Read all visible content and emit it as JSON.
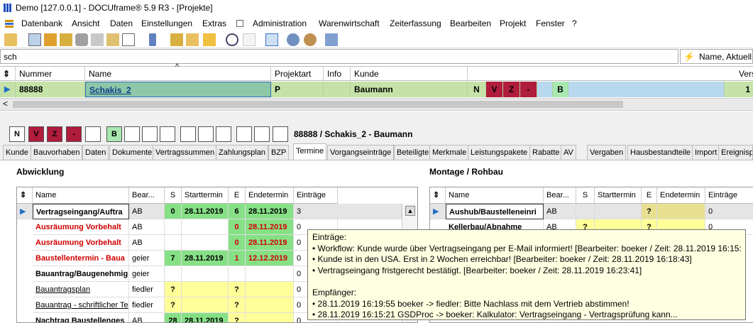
{
  "window": {
    "title": "Demo [127.0.0.1] - DOCUframe® 5.9 R3 - [Projekte]"
  },
  "menu": [
    "Datenbank",
    "Ansicht",
    "Daten",
    "Einstellungen",
    "Extras",
    "Administration",
    "Warenwirtschaft",
    "Zeiterfassung",
    "Bearbeiten",
    "Projekt",
    "Fenster",
    "?"
  ],
  "search": {
    "value": "sch",
    "filter_label": "Name, Aktuell"
  },
  "grid": {
    "headers": [
      "Nummer",
      "Name",
      "Projektart",
      "Info",
      "Kunde",
      "Vers"
    ],
    "row": {
      "nummer": "88888",
      "name": "Schakis_2",
      "projektart": "P",
      "info": "",
      "kunde": "Baumann",
      "status": [
        "N",
        "V",
        "Z",
        "-",
        "",
        "B"
      ],
      "vers": "1"
    }
  },
  "detail": {
    "status_boxes": [
      "N",
      "V",
      "Z",
      "-",
      "",
      "B",
      "",
      "",
      "",
      "",
      "",
      "",
      "",
      "",
      "",
      ""
    ],
    "summary": "88888 / Schakis_2 - Baumann",
    "tabs": [
      "Kunde",
      "Bauvorhaben",
      "Daten",
      "Dokumente",
      "Vertragssummen",
      "Zahlungsplan",
      "BZP",
      "Termine",
      "Vorgangseinträge",
      "Beteiligte",
      "Merkmale",
      "Leistungspakete",
      "Rabatte",
      "AV",
      "Vergaben",
      "Hausbestandteile",
      "Import",
      "Ereignisp"
    ],
    "active_tab": "Termine"
  },
  "abwicklung": {
    "title": "Abwicklung",
    "headers": [
      "Name",
      "Bear...",
      "S",
      "Starttermin",
      "E",
      "Endetermin",
      "Einträge"
    ],
    "rows": [
      {
        "name": "Vertragseingang/Auftra",
        "bear": "AB",
        "s": "0",
        "start": "28.11.2019",
        "e": "6",
        "end": "28.11.2019",
        "eintraege": "3"
      },
      {
        "name": "Ausräumung Vorbehalt",
        "bear": "AB",
        "s": "",
        "start": "",
        "e": "0",
        "end": "28.11.2019",
        "eintraege": "0"
      },
      {
        "name": "Ausräumung Vorbehalt",
        "bear": "AB",
        "s": "",
        "start": "",
        "e": "0",
        "end": "28.11.2019",
        "eintraege": "0"
      },
      {
        "name": "Baustellentermin - Baua",
        "bear": "geier",
        "s": "7",
        "start": "28.11.2019",
        "e": "1",
        "end": "12.12.2019",
        "eintraege": "0"
      },
      {
        "name": "Bauantrag/Baugenehmig",
        "bear": "geier",
        "s": "",
        "start": "",
        "e": "",
        "end": "",
        "eintraege": "0"
      },
      {
        "name": "Bauantragsplan",
        "bear": "fiedler",
        "s": "?",
        "start": "",
        "e": "?",
        "end": "",
        "eintraege": "0"
      },
      {
        "name": "Bauantrag - schriftlicher Te",
        "bear": "fiedler",
        "s": "?",
        "start": "",
        "e": "?",
        "end": "",
        "eintraege": "0"
      },
      {
        "name": "Nachtrag Baustellenges",
        "bear": "AB",
        "s": "28",
        "start": "28.11.2019",
        "e": "?",
        "end": "",
        "eintraege": "0"
      }
    ]
  },
  "montage": {
    "title": "Montage / Rohbau",
    "headers": [
      "Name",
      "Bear...",
      "S",
      "Starttermin",
      "E",
      "Endetermin",
      "Einträge"
    ],
    "rows": [
      {
        "name": "Aushub/Baustelleneinri",
        "bear": "AB",
        "s": "",
        "start": "",
        "e": "?",
        "end": "",
        "eintraege": "0"
      },
      {
        "name": "Kellerbau/Abnahme",
        "bear": "AB",
        "s": "?",
        "start": "",
        "e": "?",
        "end": "",
        "eintraege": "0"
      }
    ]
  },
  "tooltip": {
    "lines": [
      "Einträge:",
      "• Workflow: Kunde wurde über Vertragseingang per E-Mail informiert! [Bearbeiter: boeker / Zeit: 28.11.2019 16:15:21]",
      "• Kunde ist in den USA. Erst in 2 Wochen erreichbar! [Bearbeiter: boeker / Zeit: 28.11.2019 16:18:43]",
      "• Vertragseingang fristgerecht bestätigt. [Bearbeiter: boeker / Zeit: 28.11.2019 16:23:41]",
      "",
      "Empfänger:",
      "• 28.11.2019 16:19:55  boeker -> fiedler: Bitte Nachlass mit dem Vertrieb abstimmen!",
      "• 28.11.2019 16:15:21  GSDProc -> boeker: Kalkulator: Vertragseingang - Vertragsprüfung kann..."
    ]
  },
  "colors": {
    "green": "#86e086",
    "yellow": "#ffff99",
    "red": "#c0143c",
    "row_green": "#c5e3a8"
  }
}
